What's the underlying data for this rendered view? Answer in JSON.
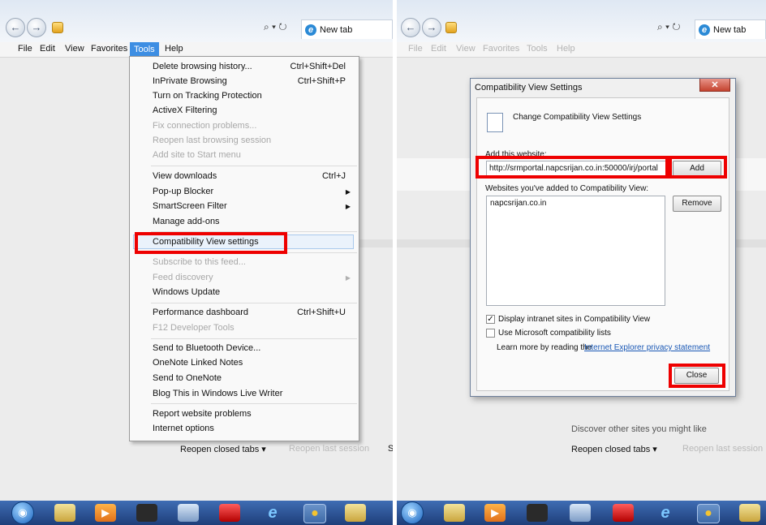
{
  "browser": {
    "new_tab_label": "New tab",
    "address_tools": "⌕ ▾ ↻",
    "back_glyph": "←",
    "forward_glyph": "→"
  },
  "menubar": {
    "items": [
      "File",
      "Edit",
      "View",
      "Favorites",
      "Tools",
      "Help"
    ],
    "active": "Tools"
  },
  "tools_menu": {
    "items": [
      {
        "label": "Delete browsing history...",
        "shortcut": "Ctrl+Shift+Del"
      },
      {
        "label": "InPrivate Browsing",
        "shortcut": "Ctrl+Shift+P"
      },
      {
        "label": "Turn on Tracking Protection"
      },
      {
        "label": "ActiveX Filtering"
      },
      {
        "label": "Fix connection problems...",
        "disabled": true
      },
      {
        "label": "Reopen last browsing session",
        "disabled": true
      },
      {
        "label": "Add site to Start menu",
        "disabled": true
      },
      {
        "label": "View downloads",
        "shortcut": "Ctrl+J"
      },
      {
        "label": "Pop-up Blocker",
        "submenu": true
      },
      {
        "label": "SmartScreen Filter",
        "submenu": true
      },
      {
        "label": "Manage add-ons"
      },
      {
        "label": "Compatibility View settings",
        "highlighted": true
      },
      {
        "label": "Subscribe to this feed...",
        "disabled": true
      },
      {
        "label": "Feed discovery",
        "disabled": true,
        "submenu": true
      },
      {
        "label": "Windows Update"
      },
      {
        "label": "Performance dashboard",
        "shortcut": "Ctrl+Shift+U"
      },
      {
        "label": "F12 Developer Tools",
        "disabled": true
      },
      {
        "label": "Send to Bluetooth Device..."
      },
      {
        "label": "OneNote Linked Notes"
      },
      {
        "label": "Send to OneNote"
      },
      {
        "label": "Blog This in Windows Live Writer"
      },
      {
        "label": "Report website problems"
      },
      {
        "label": "Internet options"
      }
    ]
  },
  "left_newtab": {
    "reopen_closed_tabs": "Reopen closed tabs ▾",
    "reopen_last_session": "Reopen last session",
    "cut_text": "S"
  },
  "right_newtab": {
    "discover": "Discover other sites you might like",
    "reopen_closed_tabs": "Reopen closed tabs ▾",
    "reopen_last_session": "Reopen last session"
  },
  "dialog": {
    "title": "Compatibility View Settings",
    "close_glyph": "✕",
    "heading": "Change Compatibility View Settings",
    "add_label": "Add this website:",
    "add_value": "http://srmportal.napcsrijan.co.in:50000/irj/portal",
    "add_button": "Add",
    "list_label": "Websites you've added to Compatibility View:",
    "list_items": [
      "napcsrijan.co.in"
    ],
    "remove_button": "Remove",
    "checkbox_intranet": {
      "label": "Display intranet sites in Compatibility View",
      "checked": true
    },
    "checkbox_ms_lists": {
      "label": "Use Microsoft compatibility lists",
      "checked": false
    },
    "learn_more": "Learn more by reading the",
    "privacy_link": "Internet Explorer privacy statement",
    "close_button": "Close"
  },
  "taskbar": {
    "icons": [
      "start-orb-icon",
      "file-explorer-icon",
      "media-player-icon",
      "app-icon",
      "utility-icon",
      "pdf-icon",
      "internet-explorer-icon",
      "chrome-icon",
      "folder-icon"
    ],
    "start_glyph": "◉",
    "media_glyph": "▶",
    "ie_glyph": "e",
    "chrome_glyph": "●"
  },
  "annotation_color": "#e00000"
}
